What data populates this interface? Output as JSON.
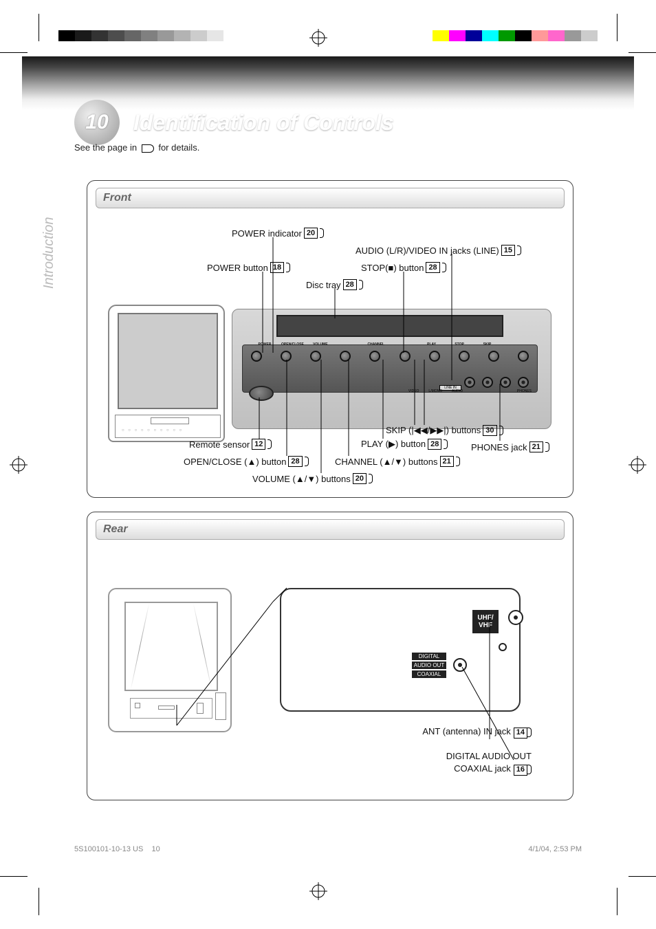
{
  "page_number": "10",
  "title": "Identification of Controls",
  "see_pages_prefix": "See the page in",
  "see_pages_suffix": "for details.",
  "sidebar": "Introduction",
  "panels": {
    "front": {
      "title": "Front"
    },
    "rear": {
      "title": "Rear"
    }
  },
  "front_labels": {
    "power_indicator": {
      "text": "POWER indicator",
      "ref": "20"
    },
    "power_button": {
      "text": "POWER button",
      "ref": "18"
    },
    "disc_tray": {
      "text": "Disc tray",
      "ref": "28"
    },
    "audio_video_in": {
      "text": "AUDIO (L/R)/VIDEO IN jacks (LINE)",
      "ref": "15"
    },
    "stop_button": {
      "text": "STOP(■) button",
      "ref": "28"
    },
    "remote_sensor": {
      "text": "Remote sensor",
      "ref": "12"
    },
    "open_close": {
      "text": "OPEN/CLOSE (▲) button",
      "ref": "28"
    },
    "volume": {
      "text": "VOLUME (▲/▼) buttons",
      "ref": "20"
    },
    "channel": {
      "text": "CHANNEL (▲/▼) buttons",
      "ref": "21"
    },
    "play": {
      "text": "PLAY (▶) button",
      "ref": "28"
    },
    "skip": {
      "text": "SKIP (|◀◀/▶▶|) buttons",
      "ref": "30"
    },
    "phones": {
      "text": "PHONES jack",
      "ref": "21"
    }
  },
  "front_panel_text": {
    "b1": "POWER",
    "b2": "OPEN/CLOSE",
    "b3": "VOLUME",
    "b4": "CHANNEL",
    "b5": "PLAY",
    "b6": "STOP",
    "b7": "SKIP",
    "linein": "LINE IN",
    "video": "VIDEO",
    "lmono": "L/MONO",
    "audio": "AUDIO",
    "phones": "PHONES"
  },
  "rear_labels": {
    "uhf_line1": "UHF/",
    "uhf_line2": "VHF",
    "digital": "DIGITAL",
    "audio_out": "AUDIO OUT",
    "coaxial": "COAXIAL",
    "ant_in": {
      "text": "ANT (antenna) IN jack",
      "ref": "14"
    },
    "digital_out": {
      "text": "DIGITAL AUDIO OUT",
      "text2": "COAXIAL jack",
      "ref": "16"
    }
  },
  "footer": {
    "file": "5S100101-10-13 US",
    "page": "10",
    "date": "4/1/04, 2:53 PM"
  }
}
